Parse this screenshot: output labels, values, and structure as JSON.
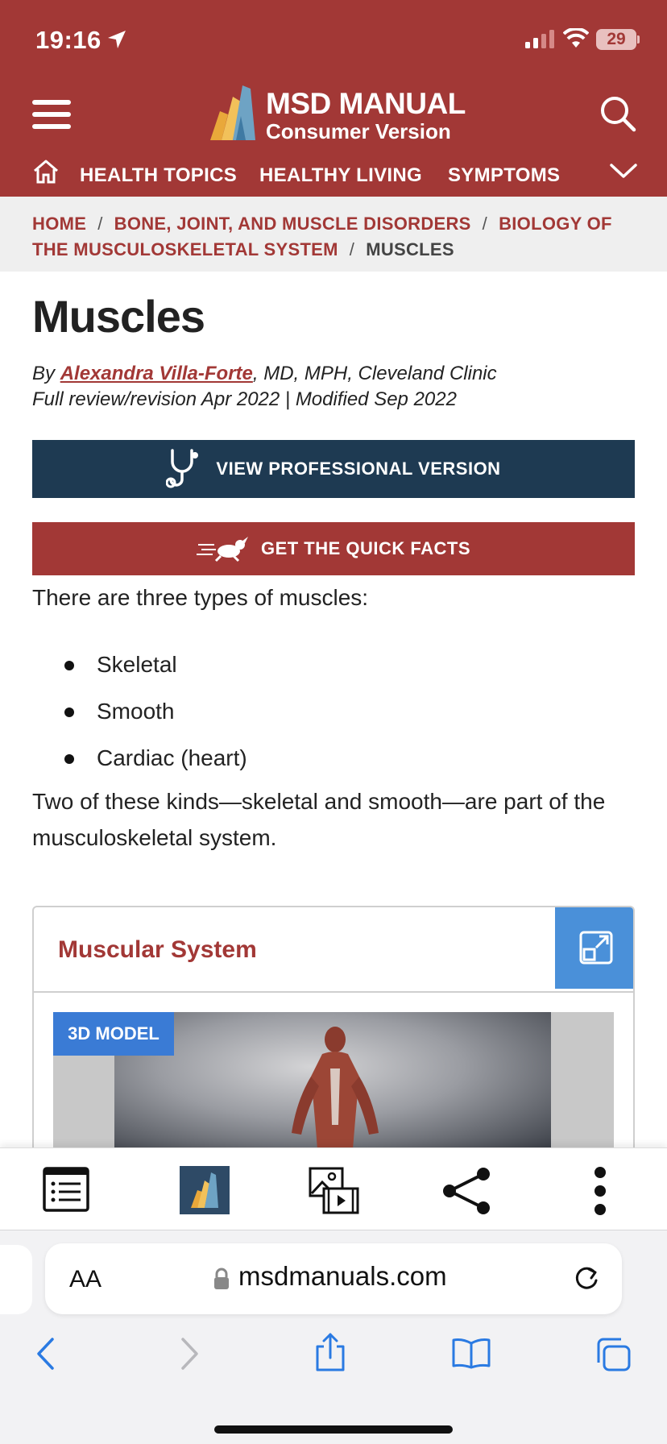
{
  "status_bar": {
    "time": "19:16",
    "battery": "29"
  },
  "header": {
    "logo_title": "MSD MANUAL",
    "logo_subtitle": "Consumer Version",
    "nav": [
      "HEALTH TOPICS",
      "HEALTHY LIVING",
      "SYMPTOMS"
    ]
  },
  "breadcrumb": {
    "items": [
      "HOME",
      "BONE, JOINT, AND MUSCLE DISORDERS",
      "BIOLOGY OF THE MUSCULOSKELETAL SYSTEM",
      "MUSCLES"
    ]
  },
  "article": {
    "title": "Muscles",
    "by_prefix": "By ",
    "author": "Alexandra Villa-Forte",
    "author_credentials": ", MD, MPH, Cleveland Clinic",
    "review": "Full review/revision Apr 2022 | Modified Sep 2022",
    "pro_button": "VIEW PROFESSIONAL VERSION",
    "facts_button": "GET THE QUICK FACTS",
    "intro": "There are three types of muscles:",
    "types": [
      "Skeletal",
      "Smooth",
      "Cardiac (heart)"
    ],
    "paragraph": "Two of these kinds—skeletal and smooth—are part of the musculoskeletal system."
  },
  "card": {
    "title": "Muscular System",
    "badge": "3D MODEL"
  },
  "toolbar": {
    "icons": [
      "list-icon",
      "msd-logo-icon",
      "media-icon",
      "share-icon",
      "more-icon"
    ]
  },
  "browser": {
    "url": "msdmanuals.com",
    "text_size_label": "AA"
  },
  "colors": {
    "brand_red": "#a23836",
    "navy": "#1e3a52",
    "accent_blue": "#3a7bd5"
  }
}
